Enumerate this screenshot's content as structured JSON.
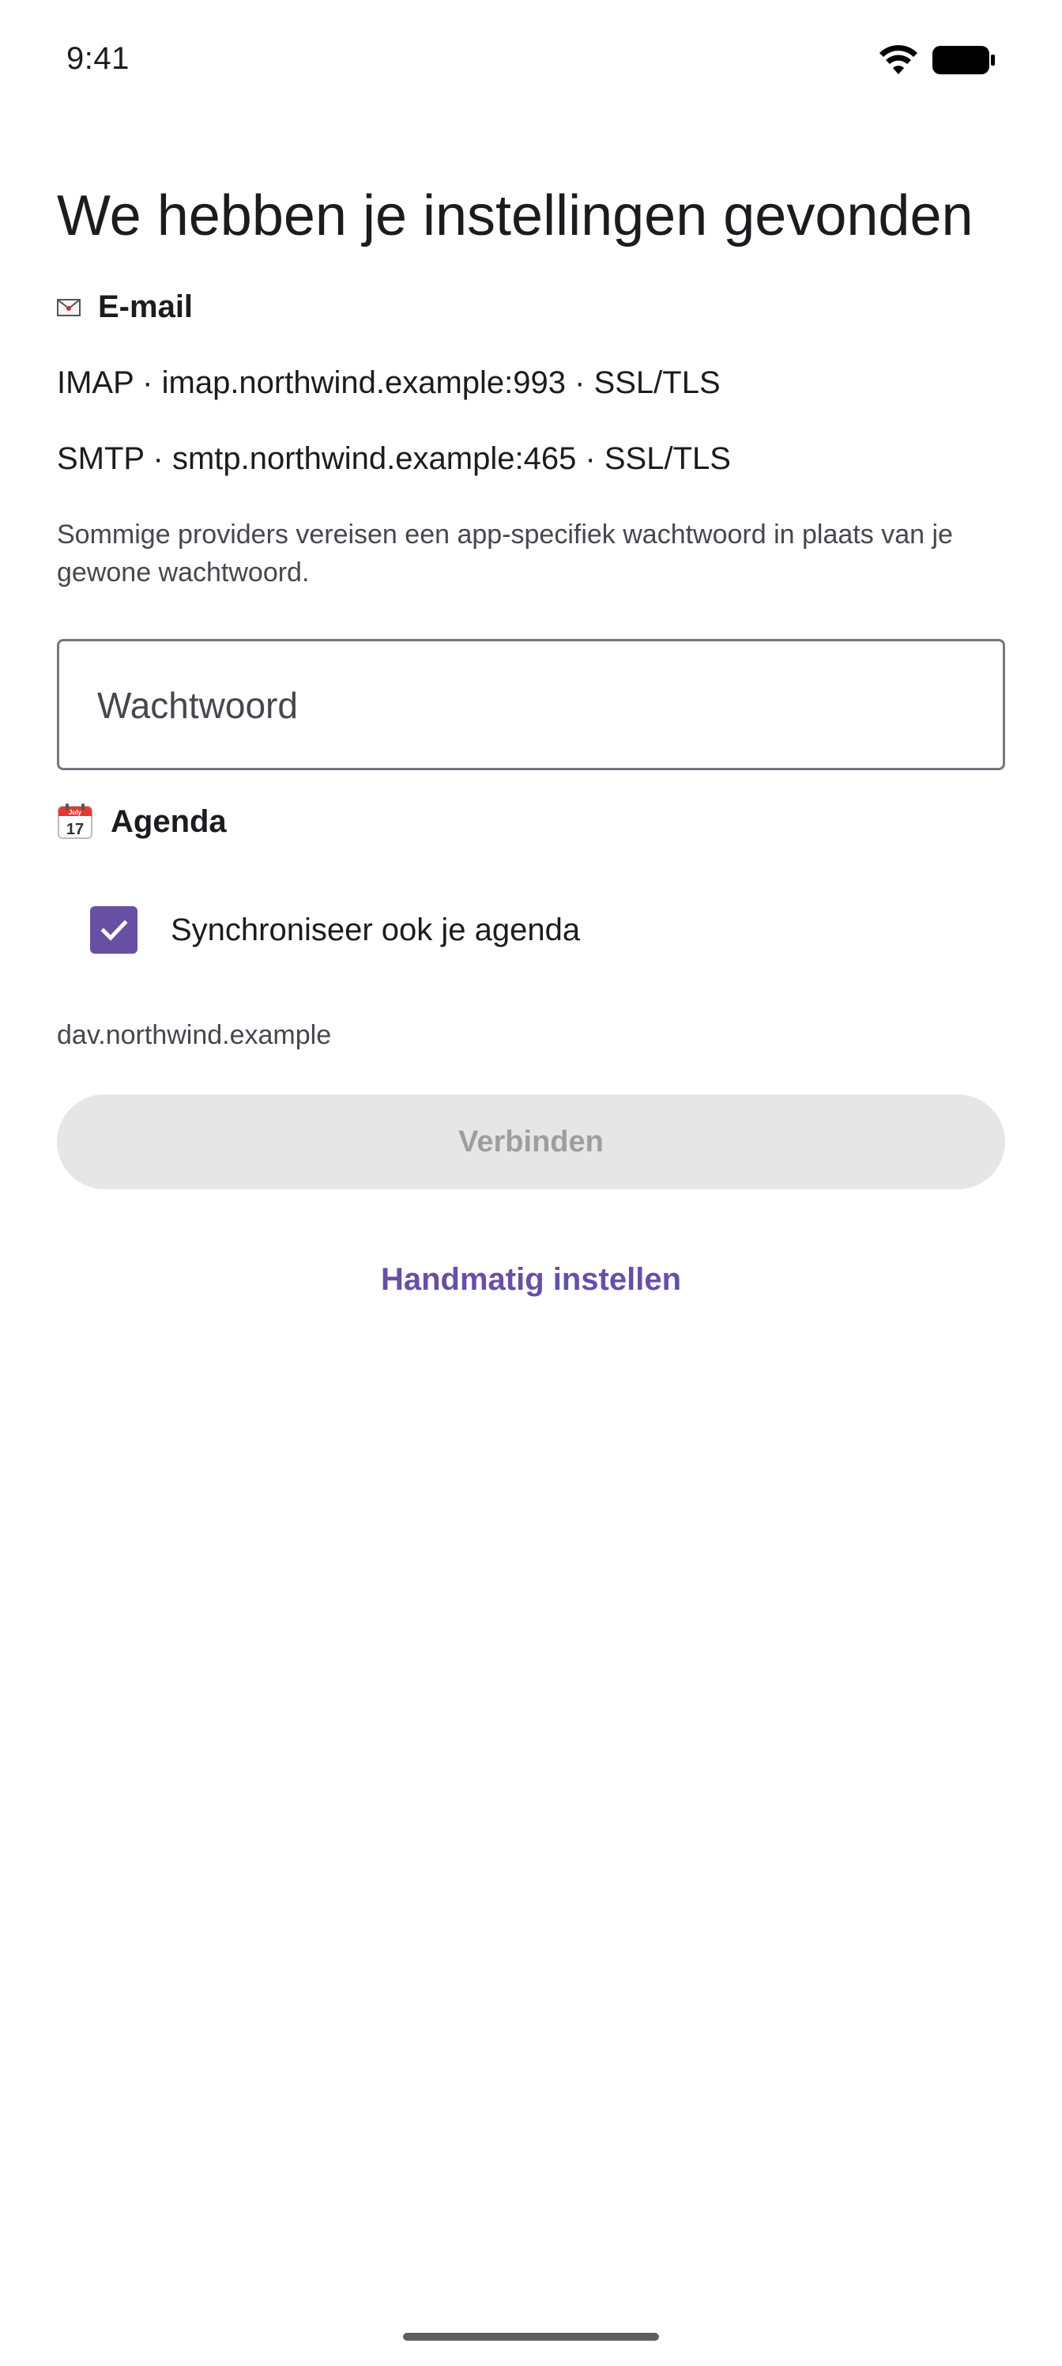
{
  "status_bar": {
    "time": "9:41",
    "wifi_icon": "wifi-icon",
    "battery_icon": "battery-icon"
  },
  "title": "We hebben je instellingen gevonden",
  "email_section": {
    "icon": "envelope-icon",
    "label": "E-mail",
    "imap": "IMAP · imap.northwind.example:993 · SSL/TLS",
    "smtp": "SMTP · smtp.northwind.example:465 · SSL/TLS",
    "hint": "Sommige providers vereisen een app-specifiek wachtwoord in plaats van je gewone wachtwoord.",
    "password": {
      "placeholder": "Wachtwoord",
      "value": ""
    }
  },
  "agenda_section": {
    "icon": "calendar-icon",
    "label": "Agenda",
    "calendar_day": "17",
    "calendar_month": "July",
    "sync_checkbox": {
      "label": "Synchroniseer ook je agenda",
      "checked": true
    },
    "dav_host": "dav.northwind.example"
  },
  "actions": {
    "connect_label": "Verbinden",
    "manual_label": "Handmatig instellen"
  },
  "colors": {
    "accent": "#6750a4",
    "disabled_bg": "#e6e6e6",
    "disabled_text": "#9e9e9e"
  }
}
